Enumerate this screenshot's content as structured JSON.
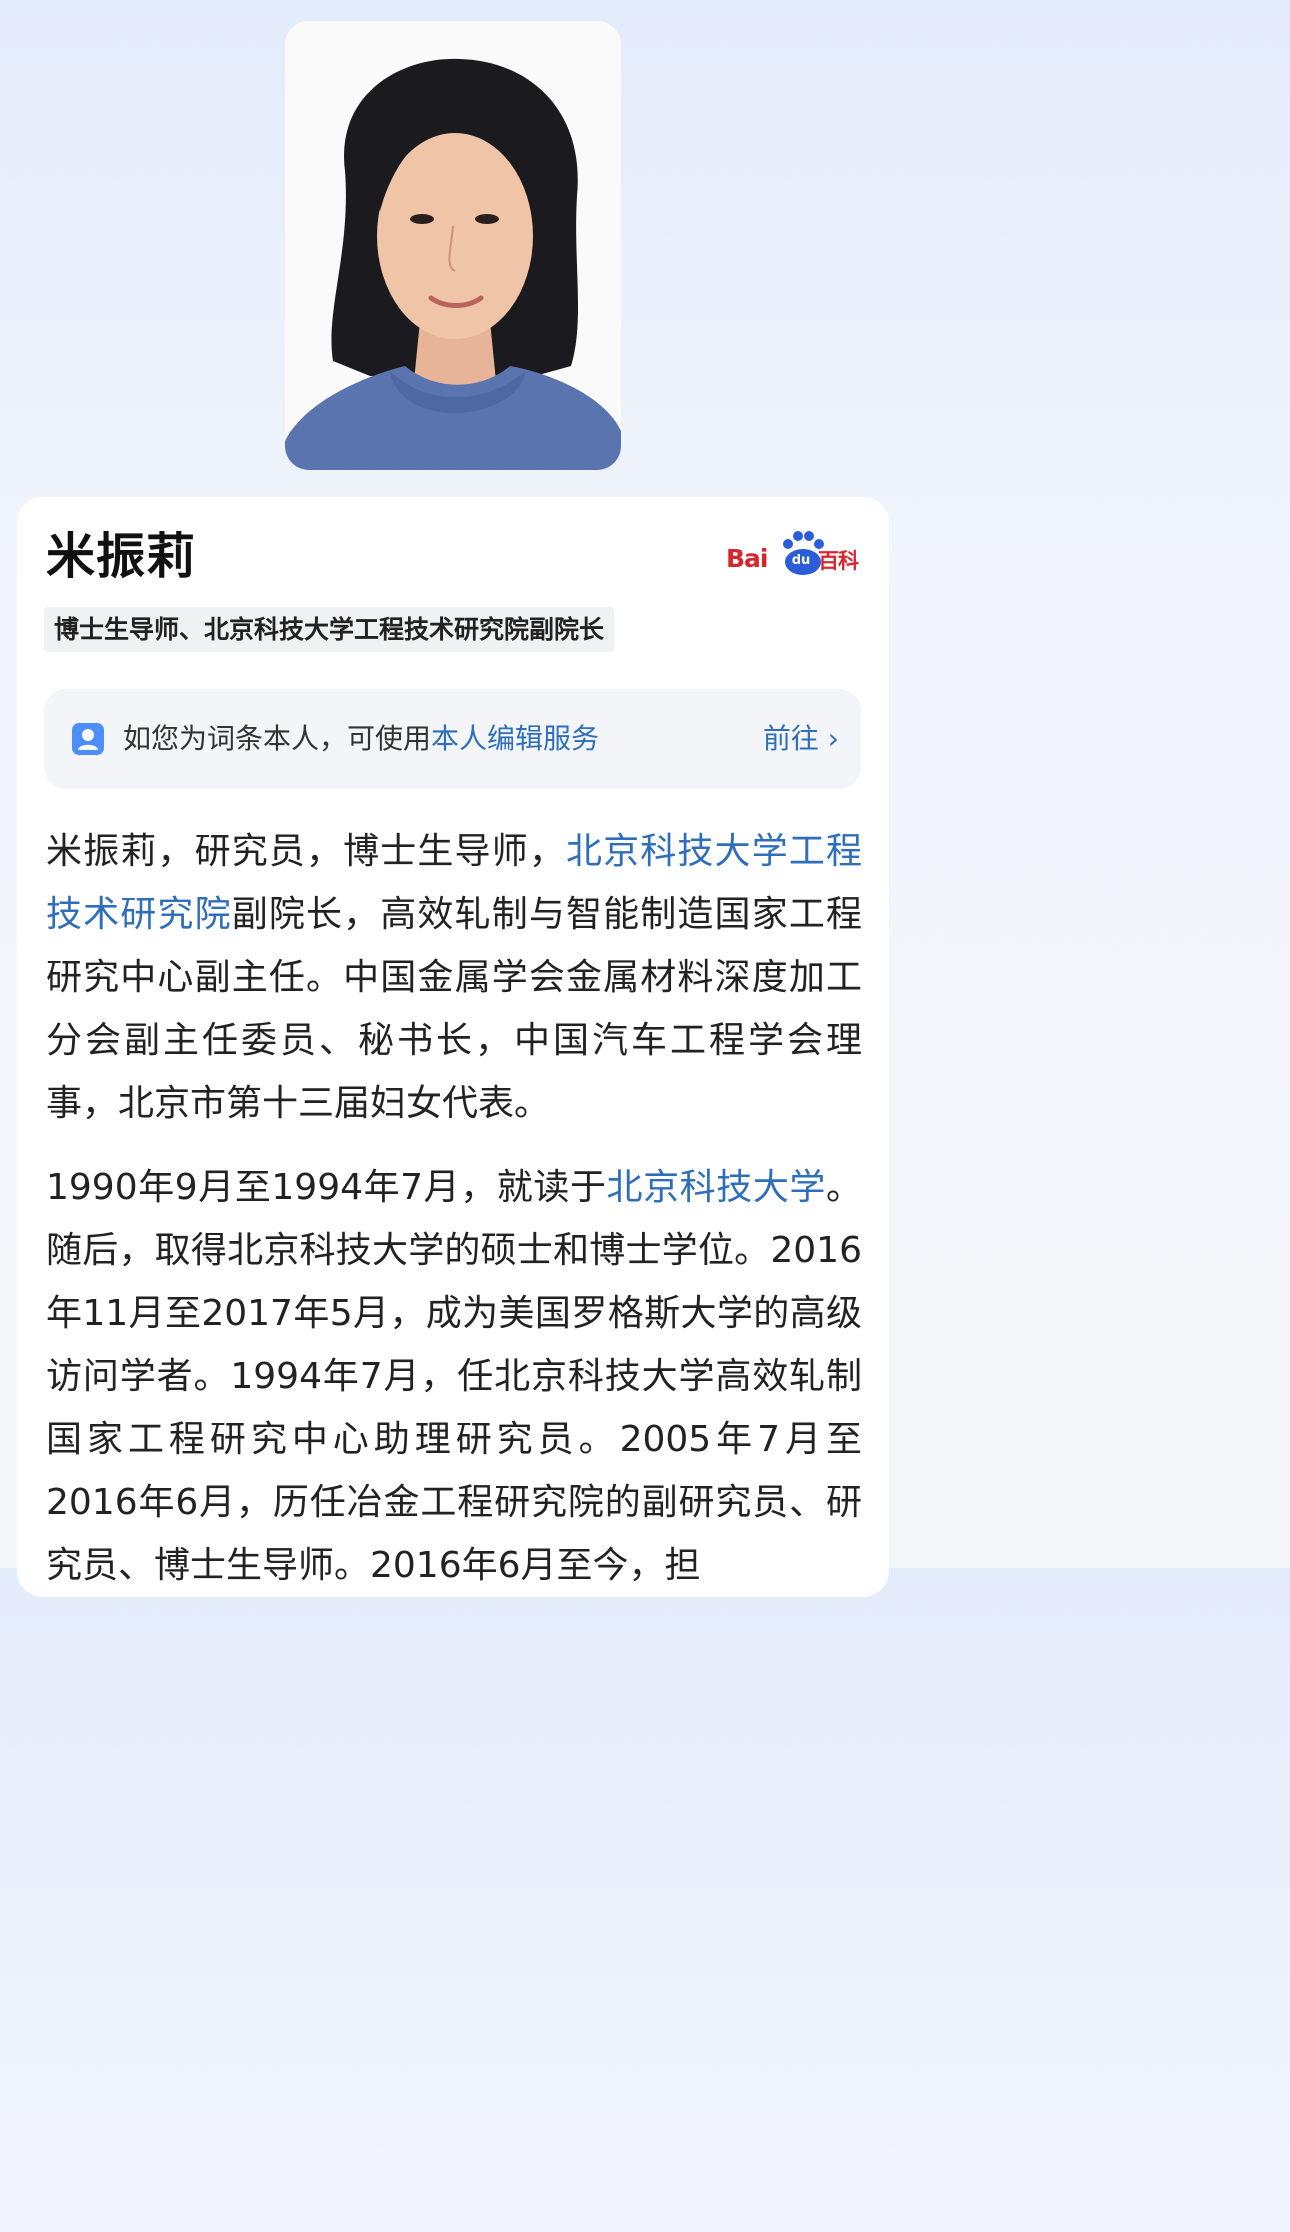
{
  "profile": {
    "name": "米振莉",
    "tag": "博士生导师、北京科技大学工程技术研究院副院长",
    "photo_alt": "米振莉"
  },
  "logo": {
    "bai": "Bai",
    "du": "du",
    "baike": "百科"
  },
  "notice": {
    "text_prefix": "如您为词条本人，可使用",
    "link_text": "本人编辑服务",
    "go_label": "前往 ›"
  },
  "body": {
    "p1_a": "米振莉，研究员，博士生导师，",
    "p1_link": "北京科技大学工程技术研究院",
    "p1_b": "副院长，高效轧制与智能制造国家工程研究中心副主任。中国金属学会金属材料深度加工分会副主任委员、秘书长，中国汽车工程学会理事，北京市第十三届妇女代表。",
    "p2_a": "1990年9月至1994年7月，就读于",
    "p2_link": "北京科技大学",
    "p2_b": "。随后，取得北京科技大学的硕士和博士学位。2016年11月至2017年5月，成为美国罗格斯大学的高级访问学者。1994年7月，任北京科技大学高效轧制国家工程研究中心助理研究员。2005年7月至2016年6月，历任冶金工程研究院的副研究员、研究员、博士生导师。2016年6月至今，担"
  },
  "colors": {
    "accent_link": "#2f6fba",
    "brand_red": "#d9262e",
    "brand_blue": "#2b5dd8"
  }
}
